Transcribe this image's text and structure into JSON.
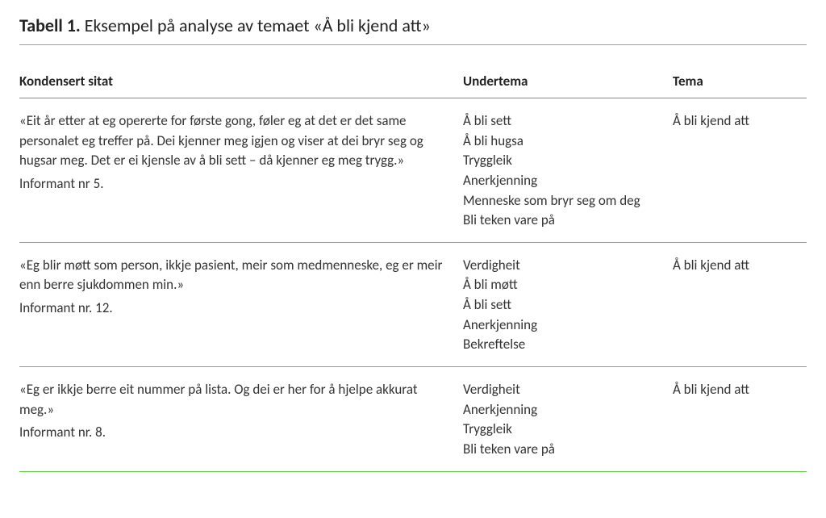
{
  "caption": {
    "label": "Tabell 1.",
    "text": " Eksempel på analyse av temaet «Å bli kjend att»"
  },
  "headers": {
    "quote": "Kondensert sitat",
    "undertema": "Undertema",
    "tema": "Tema"
  },
  "rows": [
    {
      "quote": "«Eit år etter at eg opererte for første gong, føler eg at det er det same personalet eg treffer på. Dei kjenner meg igjen og viser at dei bryr seg og hugsar meg. Det er ei kjensle av å bli sett – då kjenner eg meg trygg.»",
      "informant": "Informant nr 5.",
      "undertema": [
        "Å bli sett",
        "Å bli hugsa",
        "Tryggleik",
        "Anerkjenning",
        "Menneske som bryr seg om deg",
        "Bli teken vare på"
      ],
      "tema": "Å bli kjend att"
    },
    {
      "quote": "«Eg blir møtt som person, ikkje pasient, meir som medmenneske, eg er meir enn berre sjukdommen min.»",
      "informant": "Informant nr. 12.",
      "undertema": [
        "Verdigheit",
        "Å bli møtt",
        "Å bli sett",
        "Anerkjenning",
        "Bekreftelse"
      ],
      "tema": "Å bli kjend att"
    },
    {
      "quote": "«Eg er ikkje berre eit nummer på lista. Og dei er her for å hjelpe akkurat meg.»",
      "informant": "Informant nr. 8.",
      "undertema": [
        "Verdigheit",
        "Anerkjenning",
        "Tryggleik",
        "Bli teken vare på"
      ],
      "tema": "Å bli kjend att"
    }
  ]
}
